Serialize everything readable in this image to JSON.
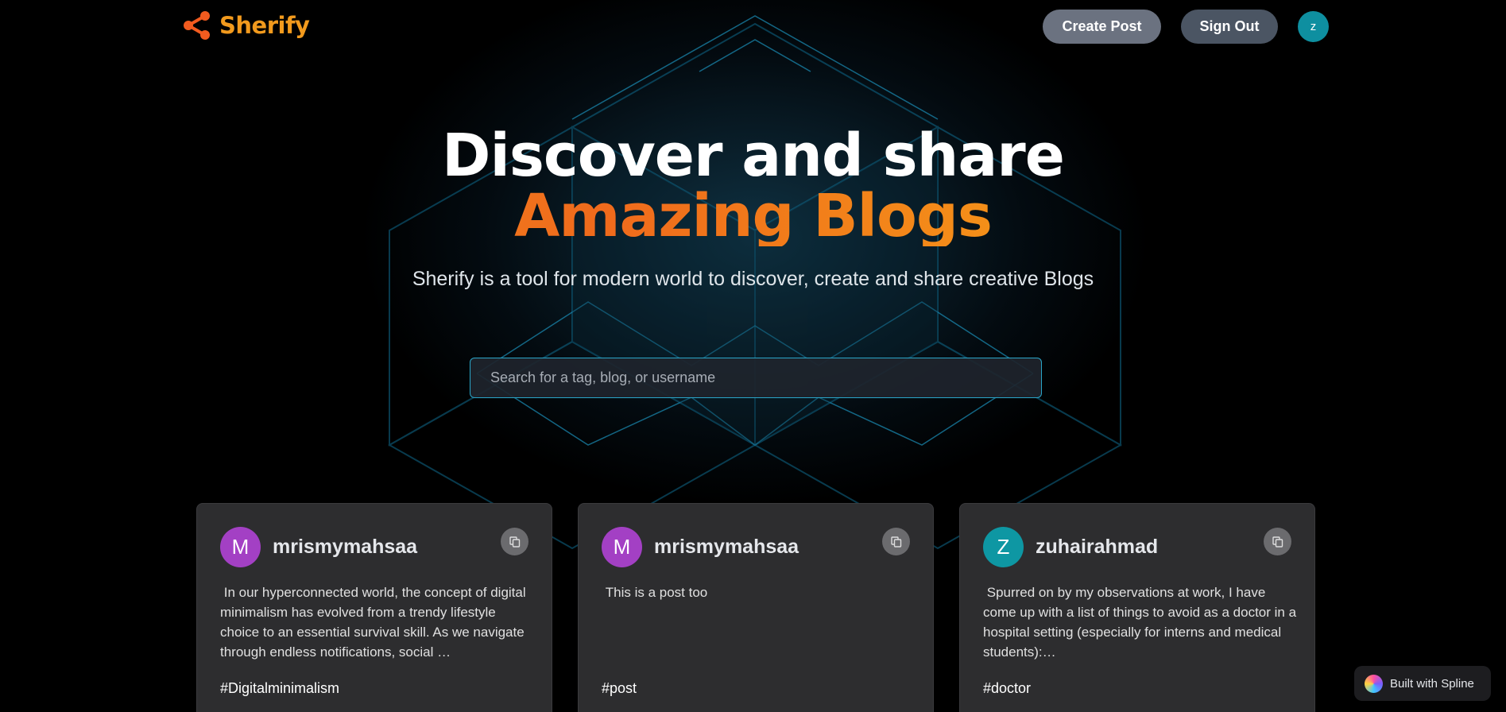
{
  "nav": {
    "brand": "Sherify",
    "create_label": "Create Post",
    "signout_label": "Sign Out",
    "avatar_initial": "z"
  },
  "hero": {
    "title_line1": "Discover and share",
    "title_line2": "Amazing Blogs",
    "subtitle": "Sherify is a tool for modern world to discover, create and share creative Blogs"
  },
  "search": {
    "placeholder": "Search for a tag, blog, or username",
    "value": ""
  },
  "posts": [
    {
      "initial": "M",
      "avatar_color": "#a340c4",
      "username": "mrismymahsaa",
      "excerpt": " In our hyperconnected world, the concept of digital minimalism has evolved from a trendy lifestyle choice to an essential survival skill. As we navigate through endless notifications, social …",
      "tag": "#Digitalminimalism"
    },
    {
      "initial": "M",
      "avatar_color": "#a340c4",
      "username": "mrismymahsaa",
      "excerpt": " This is a post too",
      "tag": "#post"
    },
    {
      "initial": "Z",
      "avatar_color": "#0e97a3",
      "username": "zuhairahmad",
      "excerpt": " Spurred on by my observations at work, I have come up with a list of things to avoid as a doctor in a hospital setting (especially for interns and medical students):…",
      "tag": "#doctor"
    }
  ],
  "badge": {
    "label": "Built with Spline"
  },
  "colors": {
    "brand": "#f29a1d",
    "search_border": "#2aa6c9"
  }
}
